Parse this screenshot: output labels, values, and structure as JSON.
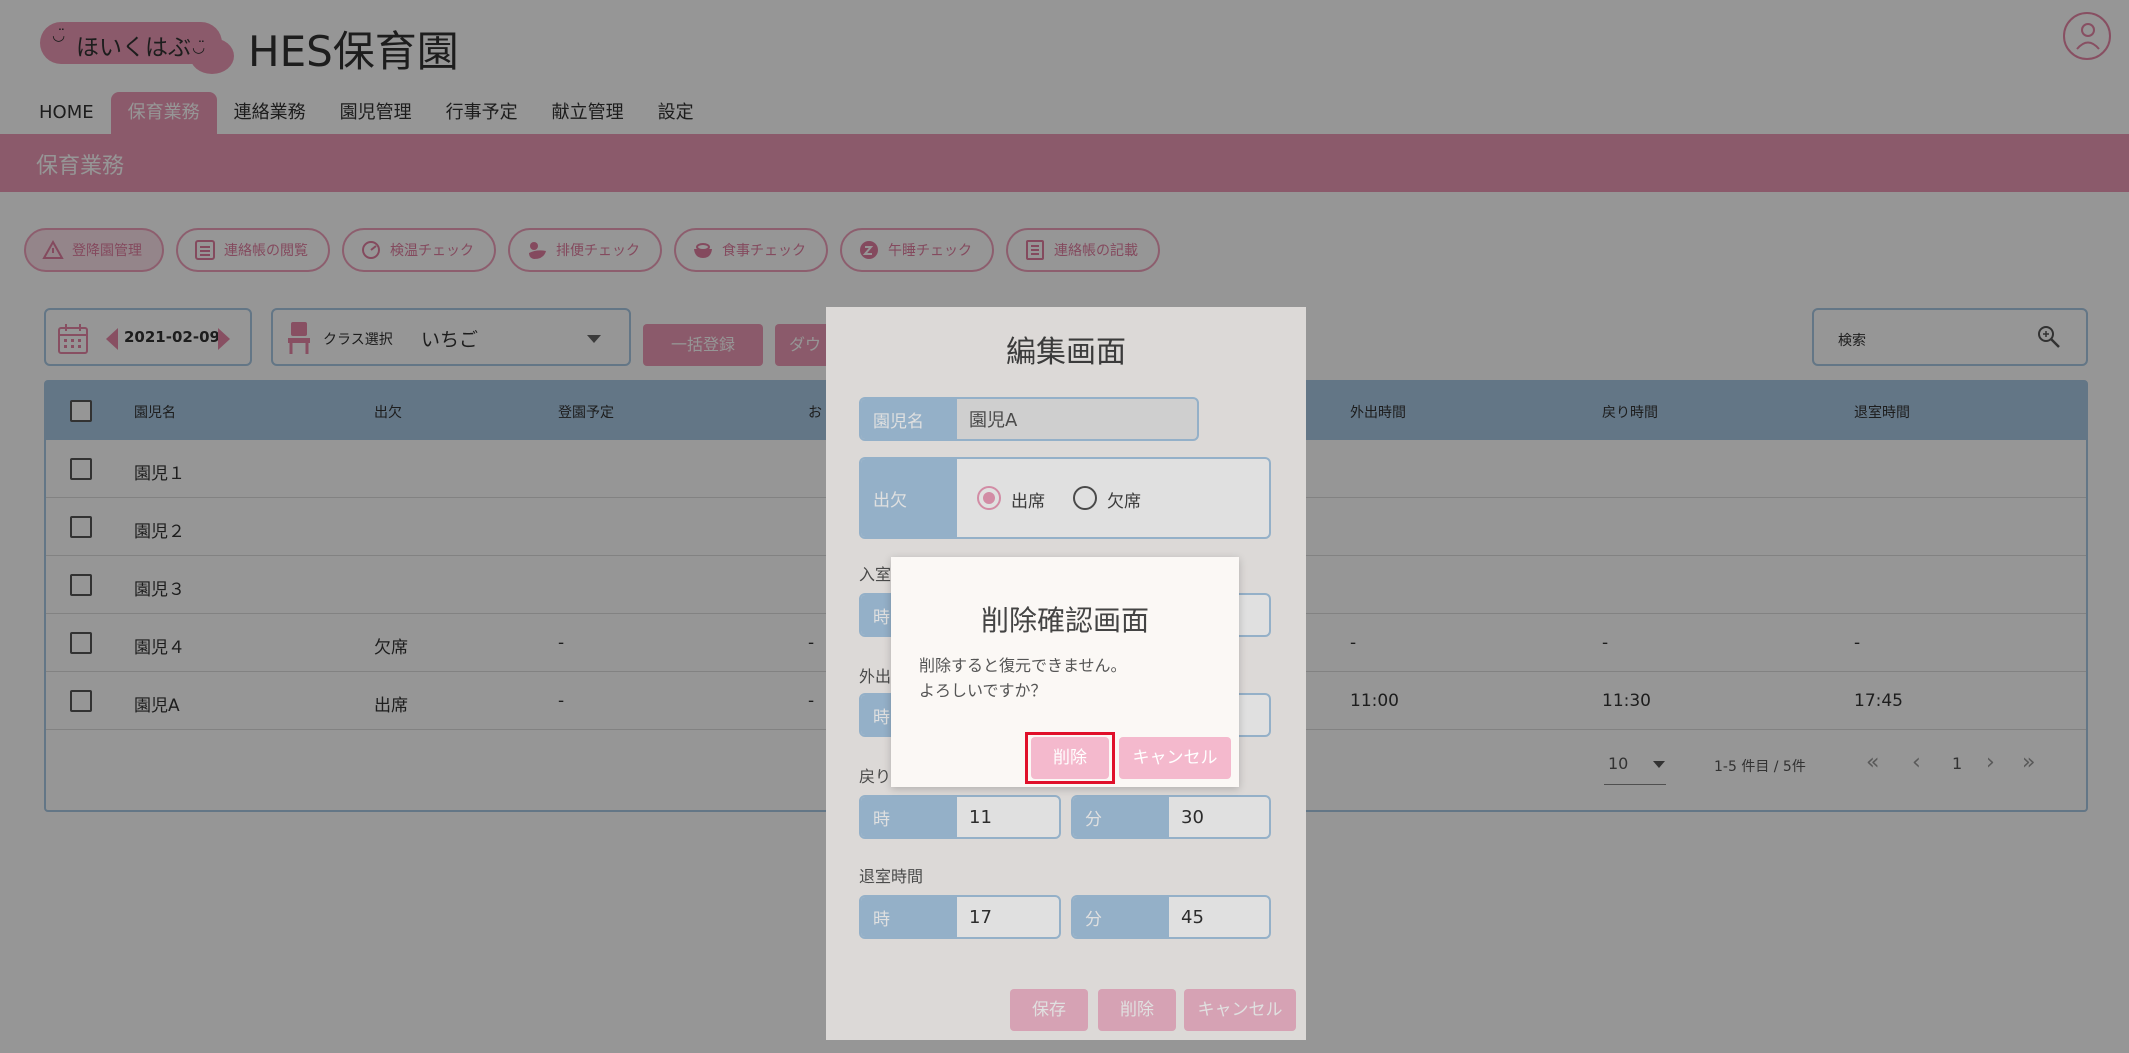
{
  "app": {
    "logo_text": "ほいくはぶ",
    "title": "HES保育園"
  },
  "nav": [
    {
      "label": "HOME"
    },
    {
      "label": "保育業務"
    },
    {
      "label": "連絡業務"
    },
    {
      "label": "園児管理"
    },
    {
      "label": "行事予定"
    },
    {
      "label": "献立管理"
    },
    {
      "label": "設定"
    }
  ],
  "section_title": "保育業務",
  "chips": [
    {
      "label": "登降園管理",
      "icon": "warning-triangle-icon"
    },
    {
      "label": "連絡帳の閲覧",
      "icon": "list-icon"
    },
    {
      "label": "検温チェック",
      "icon": "thermometer-icon"
    },
    {
      "label": "排便チェック",
      "icon": "duck-icon"
    },
    {
      "label": "食事チェック",
      "icon": "bowl-icon"
    },
    {
      "label": "午睡チェック",
      "icon": "sleep-icon"
    },
    {
      "label": "連絡帳の記載",
      "icon": "notebook-icon"
    }
  ],
  "toolbar": {
    "date": "2021-02-09",
    "class_label": "クラス選択",
    "class_value": "いちご",
    "bulk_register": "一括登録",
    "download": "ダウ",
    "search_placeholder": "検索"
  },
  "table": {
    "headers": [
      "園児名",
      "出欠",
      "登園予定",
      "お",
      "外出時間",
      "戻り時間",
      "退室時間"
    ],
    "rows": [
      {
        "name": "園児１",
        "attendance": "",
        "plan": "",
        "col4": "",
        "out": "",
        "back": "",
        "leave": ""
      },
      {
        "name": "園児２",
        "attendance": "",
        "plan": "",
        "col4": "",
        "out": "",
        "back": "",
        "leave": ""
      },
      {
        "name": "園児３",
        "attendance": "",
        "plan": "",
        "col4": "",
        "out": "",
        "back": "",
        "leave": ""
      },
      {
        "name": "園児４",
        "attendance": "欠席",
        "plan": "-",
        "col4": "-",
        "out": "-",
        "back": "-",
        "leave": "-"
      },
      {
        "name": "園児A",
        "attendance": "出席",
        "plan": "-",
        "col4": "-",
        "out": "11:00",
        "back": "11:30",
        "leave": "17:45"
      }
    ],
    "per_page": "10",
    "range": "1-5 件目 / 5件",
    "page": "1"
  },
  "edit_modal": {
    "title": "編集画面",
    "name_label": "園児名",
    "name_value": "園児A",
    "attendance_label": "出欠",
    "attend_option": "出席",
    "absent_option": "欠席",
    "section_in": "入室",
    "section_out": "外出",
    "section_back": "戻り",
    "section_leave": "退室時間",
    "hour_label": "時",
    "minute_label": "分",
    "back_hour": "11",
    "back_minute": "30",
    "leave_hour": "17",
    "leave_minute": "45",
    "save": "保存",
    "delete": "削除",
    "cancel": "キャンセル"
  },
  "confirm_dialog": {
    "title": "削除確認画面",
    "message_line1": "削除すると復元できません。",
    "message_line2": "よろしいですか？",
    "delete": "削除",
    "cancel": "キャンセル"
  },
  "colors": {
    "pink": "#ee9ab6",
    "blue": "#a9c9e4",
    "highlight": "#e0102a"
  }
}
